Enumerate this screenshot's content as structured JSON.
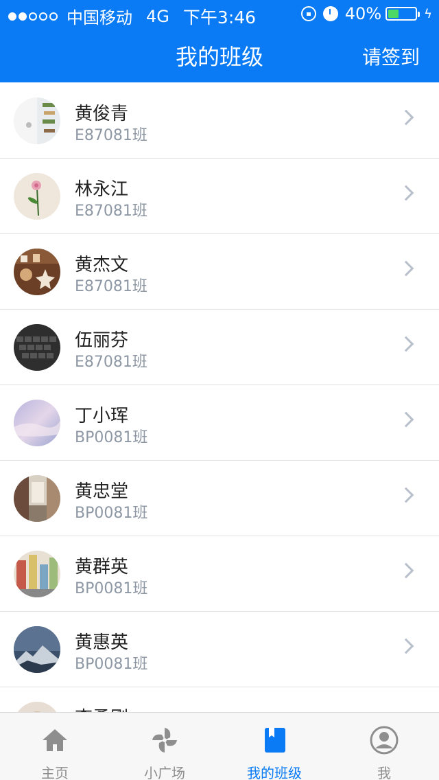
{
  "status_bar": {
    "carrier": "中国移动",
    "network": "4G",
    "time": "下午3:46",
    "battery_percent": "40%",
    "battery_level": 0.4,
    "signal_strength": 2
  },
  "nav": {
    "title": "我的班级",
    "action_label": "请签到"
  },
  "students": [
    {
      "name": "黄俊青",
      "class": "E87081班",
      "avatar": "avatar-photo-icon"
    },
    {
      "name": "林永江",
      "class": "E87081班",
      "avatar": "flower-photo-icon"
    },
    {
      "name": "黄杰文",
      "class": "E87081班",
      "avatar": "cookies-photo-icon"
    },
    {
      "name": "伍丽芬",
      "class": "E87081班",
      "avatar": "keyboard-photo-icon"
    },
    {
      "name": "丁小珲",
      "class": "BP0081班",
      "avatar": "sky-photo-icon"
    },
    {
      "name": "黄忠堂",
      "class": "BP0081班",
      "avatar": "street-photo-icon"
    },
    {
      "name": "黄群英",
      "class": "BP0081班",
      "avatar": "city-photo-icon"
    },
    {
      "name": "黄惠英",
      "class": "BP0081班",
      "avatar": "mountain-photo-icon"
    },
    {
      "name": "李勇刚",
      "class": "",
      "avatar": "person-photo-icon"
    }
  ],
  "tabbar": {
    "items": [
      {
        "label": "主页",
        "icon": "home-icon",
        "active": false
      },
      {
        "label": "小广场",
        "icon": "pinwheel-icon",
        "active": false
      },
      {
        "label": "我的班级",
        "icon": "book-icon",
        "active": true
      },
      {
        "label": "我",
        "icon": "profile-icon",
        "active": false
      }
    ]
  },
  "colors": {
    "brand_blue": "#0a7bf5",
    "battery_green": "#4cd964",
    "subtitle_gray": "#8e98a4"
  }
}
